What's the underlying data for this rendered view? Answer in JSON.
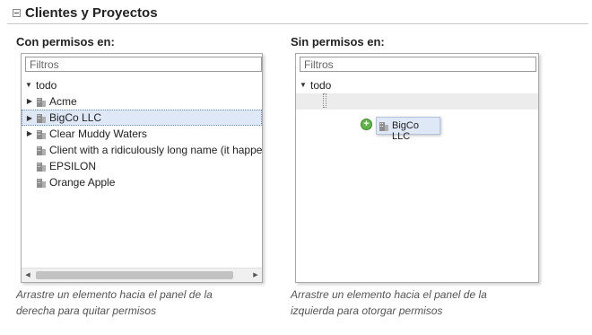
{
  "section": {
    "title": "Clientes y Proyectos"
  },
  "left_panel": {
    "heading": "Con permisos en:",
    "filter_placeholder": "Filtros",
    "root": "todo",
    "items": [
      {
        "label": "Acme",
        "expandable": true,
        "selected": false
      },
      {
        "label": "BigCo LLC",
        "expandable": true,
        "selected": true
      },
      {
        "label": "Clear Muddy Waters",
        "expandable": true,
        "selected": false
      },
      {
        "label": "Client with a ridiculously long name (it happe",
        "expandable": false,
        "selected": false
      },
      {
        "label": "EPSILON",
        "expandable": false,
        "selected": false
      },
      {
        "label": "Orange Apple",
        "expandable": false,
        "selected": false
      }
    ],
    "help_line1": "Arrastre un elemento hacia el panel de la",
    "help_line2": "derecha para quitar permisos"
  },
  "right_panel": {
    "heading": "Sin permisos en:",
    "filter_placeholder": "Filtros",
    "root": "todo",
    "help_line1": "Arrastre un elemento hacia el panel de la",
    "help_line2": "izquierda para otorgar permisos"
  },
  "drag": {
    "label": "BigCo LLC",
    "add_symbol": "+"
  },
  "colors": {
    "selection": "#dfe8f6",
    "add_icon": "#5fb546",
    "scroll_thumb": "#c2c2c2"
  }
}
